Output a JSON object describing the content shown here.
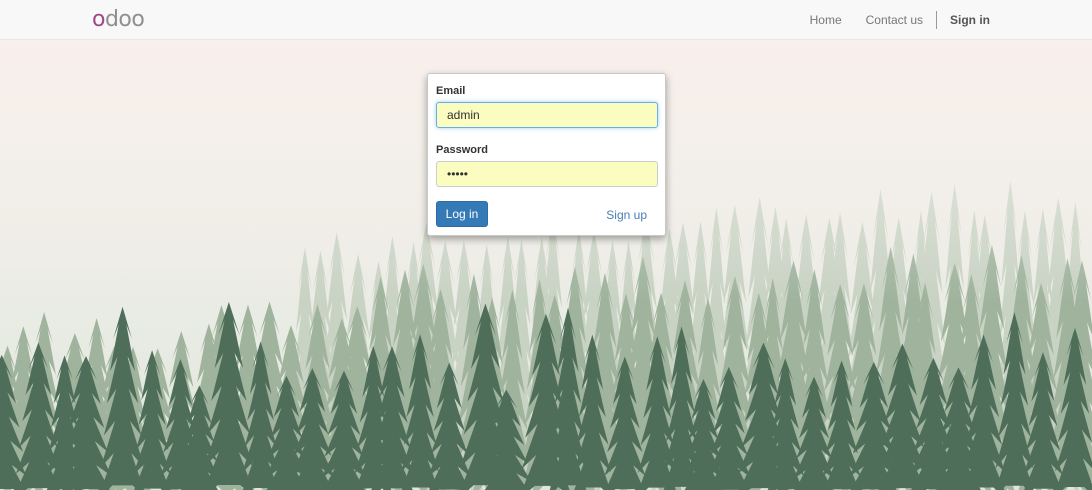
{
  "brand": {
    "logo_text": "odoo",
    "logo_first_letter": "o",
    "logo_rest": "doo",
    "logo_accent_color": "#a24689"
  },
  "navbar": {
    "links": [
      {
        "label": "Home"
      },
      {
        "label": "Contact us"
      }
    ],
    "signin_label": "Sign in"
  },
  "login": {
    "email_label": "Email",
    "email_value": "admin",
    "password_label": "Password",
    "password_value": "admin",
    "login_button_label": "Log in",
    "signup_link_label": "Sign up"
  },
  "colors": {
    "primary_button": "#337ab7",
    "autofill_background": "#fafcc0",
    "link": "#4a7eb0"
  }
}
